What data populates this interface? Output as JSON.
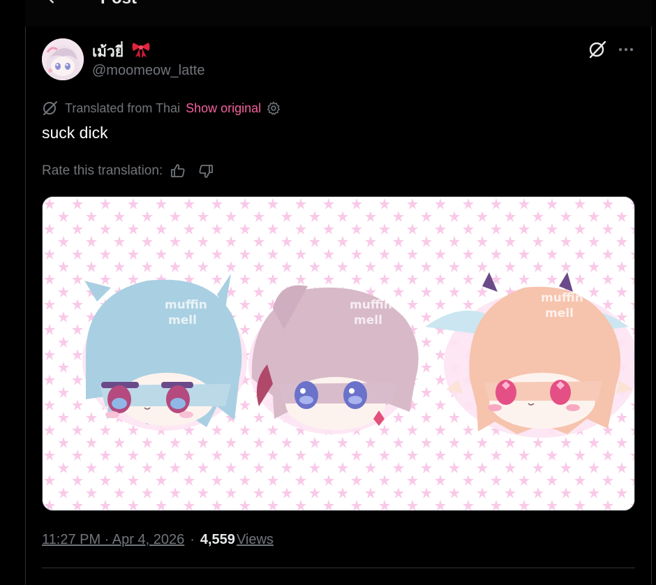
{
  "header": {
    "title": "Post",
    "back_icon": "arrow-left-icon"
  },
  "author": {
    "display_name": "เม้วยี่",
    "name_emoji": "ribbon-icon",
    "handle": "@moomeow_latte",
    "avatar": "avatar-anime-girl"
  },
  "actions": {
    "grok_icon": "grok-icon",
    "more_icon": "more-horizontal-icon"
  },
  "translation": {
    "label": "Translated from Thai",
    "show_original": "Show original",
    "settings_icon": "gear-icon"
  },
  "post": {
    "text": "suck dick"
  },
  "rating": {
    "label": "Rate this translation:",
    "like_icon": "thumbs-up-icon",
    "dislike_icon": "thumbs-down-icon"
  },
  "media": {
    "description": "chibi-heads-stars-background",
    "watermark_line1": "muffin",
    "watermark_line2": "mell"
  },
  "meta": {
    "timestamp": "11:27 PM · Apr 4, 2026",
    "separator": "·",
    "views_count": "4,559",
    "views_label": "Views"
  },
  "colors": {
    "accent": "#f4619e",
    "muted": "#71767b",
    "background": "#000000",
    "text": "#e7e9ea"
  }
}
